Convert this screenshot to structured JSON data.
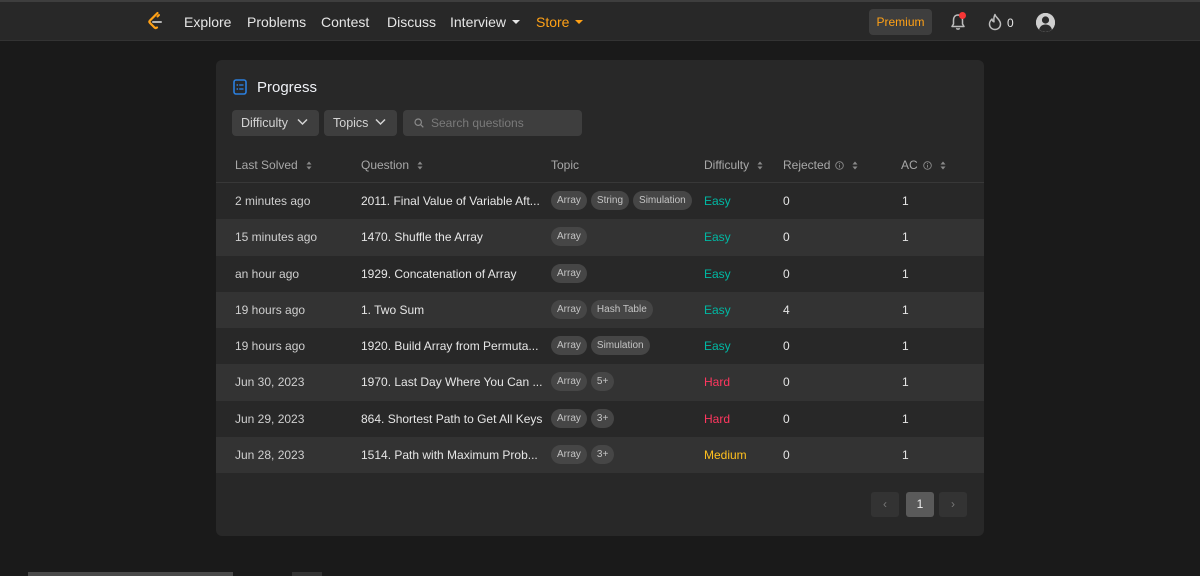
{
  "nav": {
    "items": [
      "Explore",
      "Problems",
      "Contest",
      "Discuss",
      "Interview",
      "Store"
    ],
    "premium_label": "Premium",
    "coins": "0",
    "accent": "#ffa116"
  },
  "progress": {
    "title": "Progress",
    "filters": {
      "difficulty": "Difficulty",
      "topics": "Topics",
      "search_placeholder": "Search questions"
    },
    "columns": [
      "Last Solved",
      "Question",
      "Topic",
      "Difficulty",
      "Rejected",
      "AC"
    ],
    "rows": [
      {
        "last_solved": "2 minutes ago",
        "question": "2011. Final Value of Variable Aft...",
        "topics": [
          "Array",
          "String",
          "Simulation"
        ],
        "difficulty": "Easy",
        "rejected": "0",
        "ac": "1"
      },
      {
        "last_solved": "15 minutes ago",
        "question": "1470. Shuffle the Array",
        "topics": [
          "Array"
        ],
        "difficulty": "Easy",
        "rejected": "0",
        "ac": "1"
      },
      {
        "last_solved": "an hour ago",
        "question": "1929. Concatenation of Array",
        "topics": [
          "Array"
        ],
        "difficulty": "Easy",
        "rejected": "0",
        "ac": "1"
      },
      {
        "last_solved": "19 hours ago",
        "question": "1. Two Sum",
        "topics": [
          "Array",
          "Hash Table"
        ],
        "difficulty": "Easy",
        "rejected": "4",
        "ac": "1"
      },
      {
        "last_solved": "19 hours ago",
        "question": "1920. Build Array from Permuta...",
        "topics": [
          "Array",
          "Simulation"
        ],
        "difficulty": "Easy",
        "rejected": "0",
        "ac": "1"
      },
      {
        "last_solved": "Jun 30, 2023",
        "question": "1970. Last Day Where You Can ...",
        "topics": [
          "Array",
          "5+"
        ],
        "difficulty": "Hard",
        "rejected": "0",
        "ac": "1"
      },
      {
        "last_solved": "Jun 29, 2023",
        "question": "864. Shortest Path to Get All Keys",
        "topics": [
          "Array",
          "3+"
        ],
        "difficulty": "Hard",
        "rejected": "0",
        "ac": "1"
      },
      {
        "last_solved": "Jun 28, 2023",
        "question": "1514. Path with Maximum Prob...",
        "topics": [
          "Array",
          "3+"
        ],
        "difficulty": "Medium",
        "rejected": "0",
        "ac": "1"
      }
    ],
    "pagination": {
      "prev": "‹",
      "current": "1",
      "next": "›"
    },
    "colors": {
      "easy": "#00b8a3",
      "medium": "#ffc01e",
      "hard": "#ff375f"
    }
  }
}
